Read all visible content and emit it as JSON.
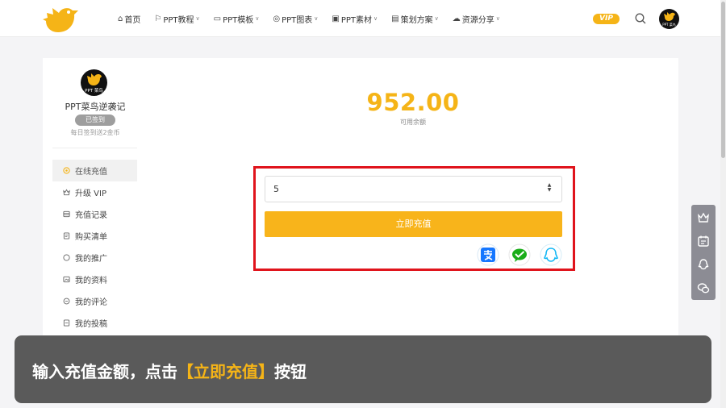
{
  "header": {
    "nav": [
      {
        "icon": "home-icon",
        "glyph": "⌂",
        "label": "首页",
        "dropdown": false
      },
      {
        "icon": "tutorial-icon",
        "glyph": "⚐",
        "label": "PPT教程",
        "dropdown": true
      },
      {
        "icon": "folder-icon",
        "glyph": "▭",
        "label": "PPT模板",
        "dropdown": true
      },
      {
        "icon": "chart-icon",
        "glyph": "◎",
        "label": "PPT图表",
        "dropdown": true
      },
      {
        "icon": "image-icon",
        "glyph": "▣",
        "label": "PPT素材",
        "dropdown": true
      },
      {
        "icon": "plan-icon",
        "glyph": "▤",
        "label": "策划方案",
        "dropdown": true
      },
      {
        "icon": "cloud-icon",
        "glyph": "☁",
        "label": "资源分享",
        "dropdown": true
      }
    ],
    "vip_label": "VIP",
    "avatar_text": "PPT 菜鸟"
  },
  "sidebar": {
    "avatar_text": "PPT 菜鸟",
    "username": "PPT菜鸟逆袭记",
    "signed_label": "已签到",
    "sign_tip": "每日签到送2金币",
    "menu": [
      {
        "icon": "recharge-icon",
        "label": "在线充值",
        "active": true
      },
      {
        "icon": "vip-crown-icon",
        "label": "升级 VIP",
        "active": false
      },
      {
        "icon": "record-icon",
        "label": "充值记录",
        "active": false
      },
      {
        "icon": "list-icon",
        "label": "购买清单",
        "active": false
      },
      {
        "icon": "promote-icon",
        "label": "我的推广",
        "active": false
      },
      {
        "icon": "profile-icon",
        "label": "我的资料",
        "active": false
      },
      {
        "icon": "comment-icon",
        "label": "我的评论",
        "active": false
      },
      {
        "icon": "post-icon",
        "label": "我的投稿",
        "active": false
      }
    ]
  },
  "main": {
    "balance": "952.00",
    "balance_label": "可用余额",
    "amount_value": "5",
    "recharge_label": "立即充值",
    "payments": [
      "alipay-icon",
      "wechat-pay-icon",
      "qq-pay-icon"
    ]
  },
  "caption": {
    "prefix": "输入充值金额，点击",
    "highlight": "【立即充值】",
    "suffix": "按钮"
  },
  "colors": {
    "accent": "#f5b417",
    "highlight_border": "#e0141c",
    "caption_bg": "#555555"
  }
}
